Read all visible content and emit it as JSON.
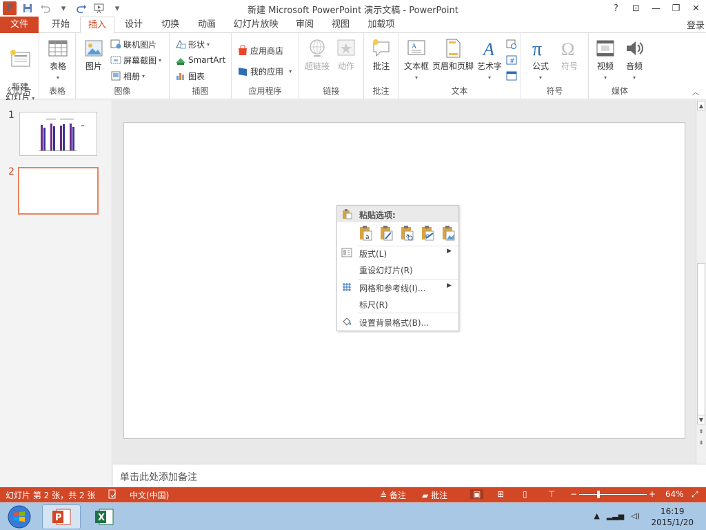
{
  "window": {
    "title": "新建 Microsoft PowerPoint 演示文稿 - PowerPoint",
    "help": "?",
    "controls": [
      "⊡",
      "—",
      "❐",
      "✕"
    ]
  },
  "qat": {
    "logo": "P"
  },
  "tabs": {
    "file": "文件",
    "items": [
      "开始",
      "插入",
      "设计",
      "切换",
      "动画",
      "幻灯片放映",
      "审阅",
      "视图",
      "加载项"
    ],
    "active": "插入",
    "signin": "登录"
  },
  "ribbon": {
    "slides": {
      "label": "幻灯片",
      "new_slide": "新建\n幻灯片"
    },
    "tables": {
      "label": "表格",
      "table": "表格"
    },
    "images": {
      "label": "图像",
      "picture": "图片",
      "online_picture": "联机图片",
      "screenshot": "屏幕截图",
      "album": "相册"
    },
    "illustrations": {
      "label": "插图",
      "shapes": "形状",
      "smartart": "SmartArt",
      "chart": "图表"
    },
    "apps": {
      "label": "应用程序",
      "store": "应用商店",
      "my_apps": "我的应用"
    },
    "links": {
      "label": "链接",
      "hyperlink": "超链接",
      "action": "动作"
    },
    "comments": {
      "label": "批注",
      "comment": "批注"
    },
    "text": {
      "label": "文本",
      "textbox": "文本框",
      "header_footer": "页眉和页脚",
      "wordart": "艺术字"
    },
    "symbols": {
      "label": "符号",
      "equation": "公式",
      "symbol": "符号"
    },
    "media": {
      "label": "媒体",
      "video": "视频",
      "audio": "音频"
    }
  },
  "thumbnails": {
    "numbers": [
      "1",
      "2"
    ]
  },
  "context_menu": {
    "paste_options": "粘贴选项:",
    "layout": "版式(L)",
    "reset": "重设幻灯片(R)",
    "grid": "网格和参考线(I)...",
    "ruler": "标尺(R)",
    "background": "设置背景格式(B)..."
  },
  "notes_placeholder": "单击此处添加备注",
  "status": {
    "slide_info": "幻灯片 第 2 张，共 2 张",
    "language": "中文(中国)",
    "notes": "备注",
    "comments": "批注",
    "zoom": "64%"
  },
  "clock": {
    "time": "16:19",
    "date": "2015/1/20"
  },
  "colors": {
    "accent": "#d24726",
    "taskbar": "#a9c8e6"
  }
}
